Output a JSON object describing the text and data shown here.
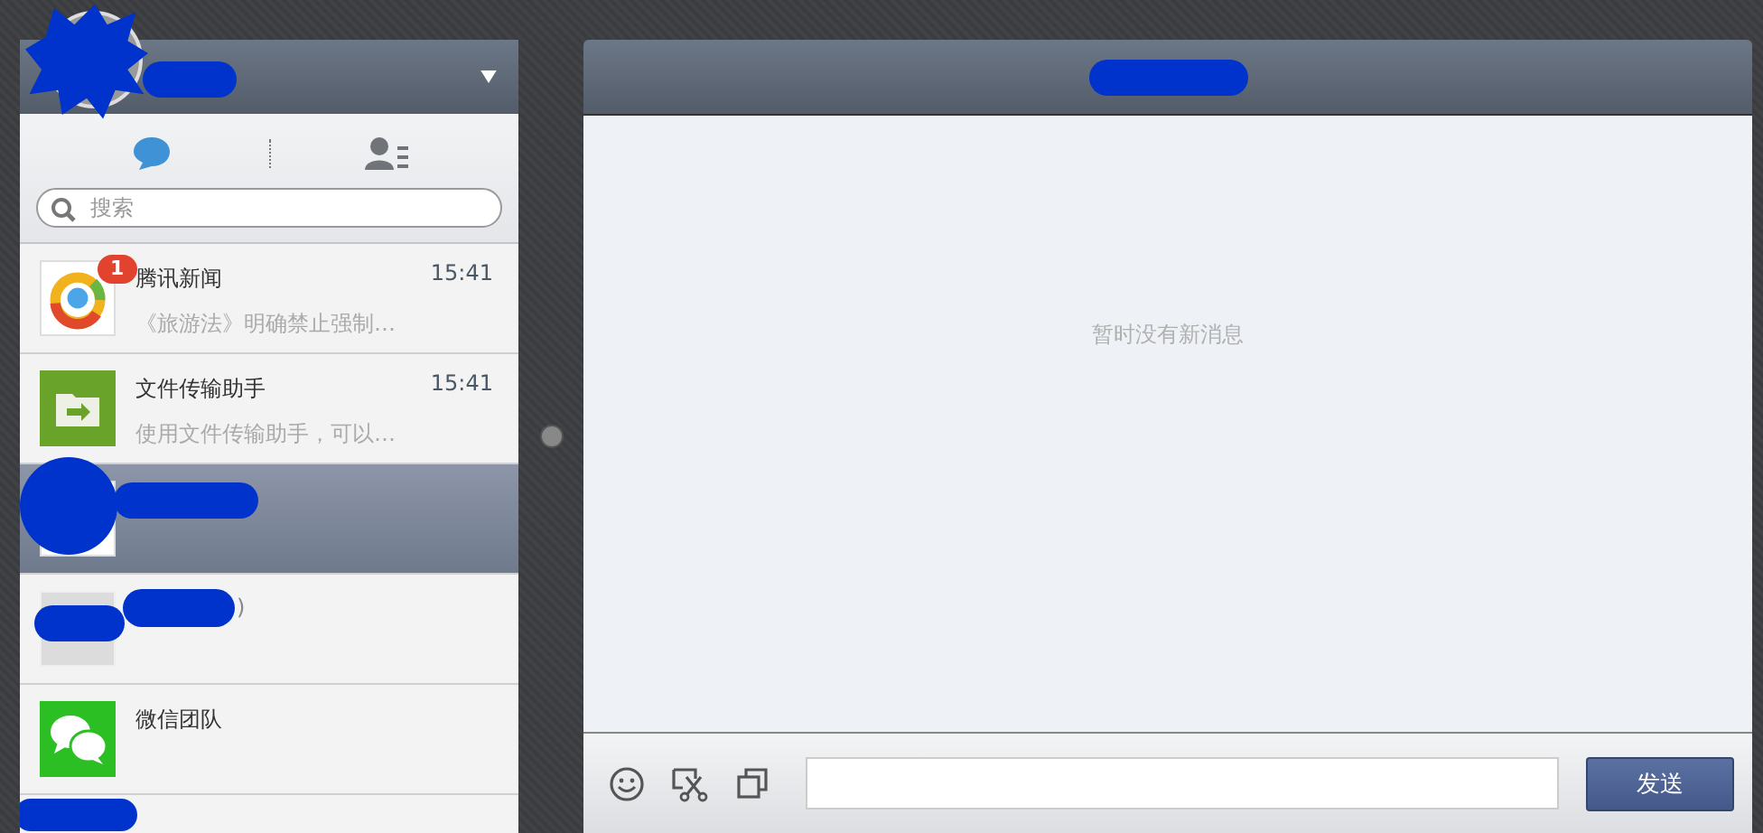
{
  "account": {
    "redacted": true
  },
  "tabs": [
    {
      "kind": "chats",
      "selected": true
    },
    {
      "kind": "contacts",
      "selected": false
    }
  ],
  "search": {
    "placeholder": "搜索"
  },
  "chats": [
    {
      "kind": "news",
      "name": "腾讯新闻",
      "time": "15:41",
      "preview": "《旅游法》明确禁止强制…",
      "badge": "1",
      "selected": false,
      "redacted": false
    },
    {
      "kind": "file",
      "name": "文件传输助手",
      "time": "15:41",
      "preview": "使用文件传输助手，可以…",
      "selected": false,
      "redacted": false
    },
    {
      "kind": "blank",
      "selected": true,
      "redacted": true
    },
    {
      "kind": "grey",
      "name": ")",
      "selected": false,
      "redacted": true
    },
    {
      "kind": "wechat",
      "name": "微信团队",
      "selected": false,
      "redacted": false
    },
    {
      "kind": "none",
      "selected": false,
      "redacted": true
    }
  ],
  "conversation": {
    "title_redacted": true,
    "empty_message": "暂时没有新消息"
  },
  "composer": {
    "send_label": "发送"
  }
}
